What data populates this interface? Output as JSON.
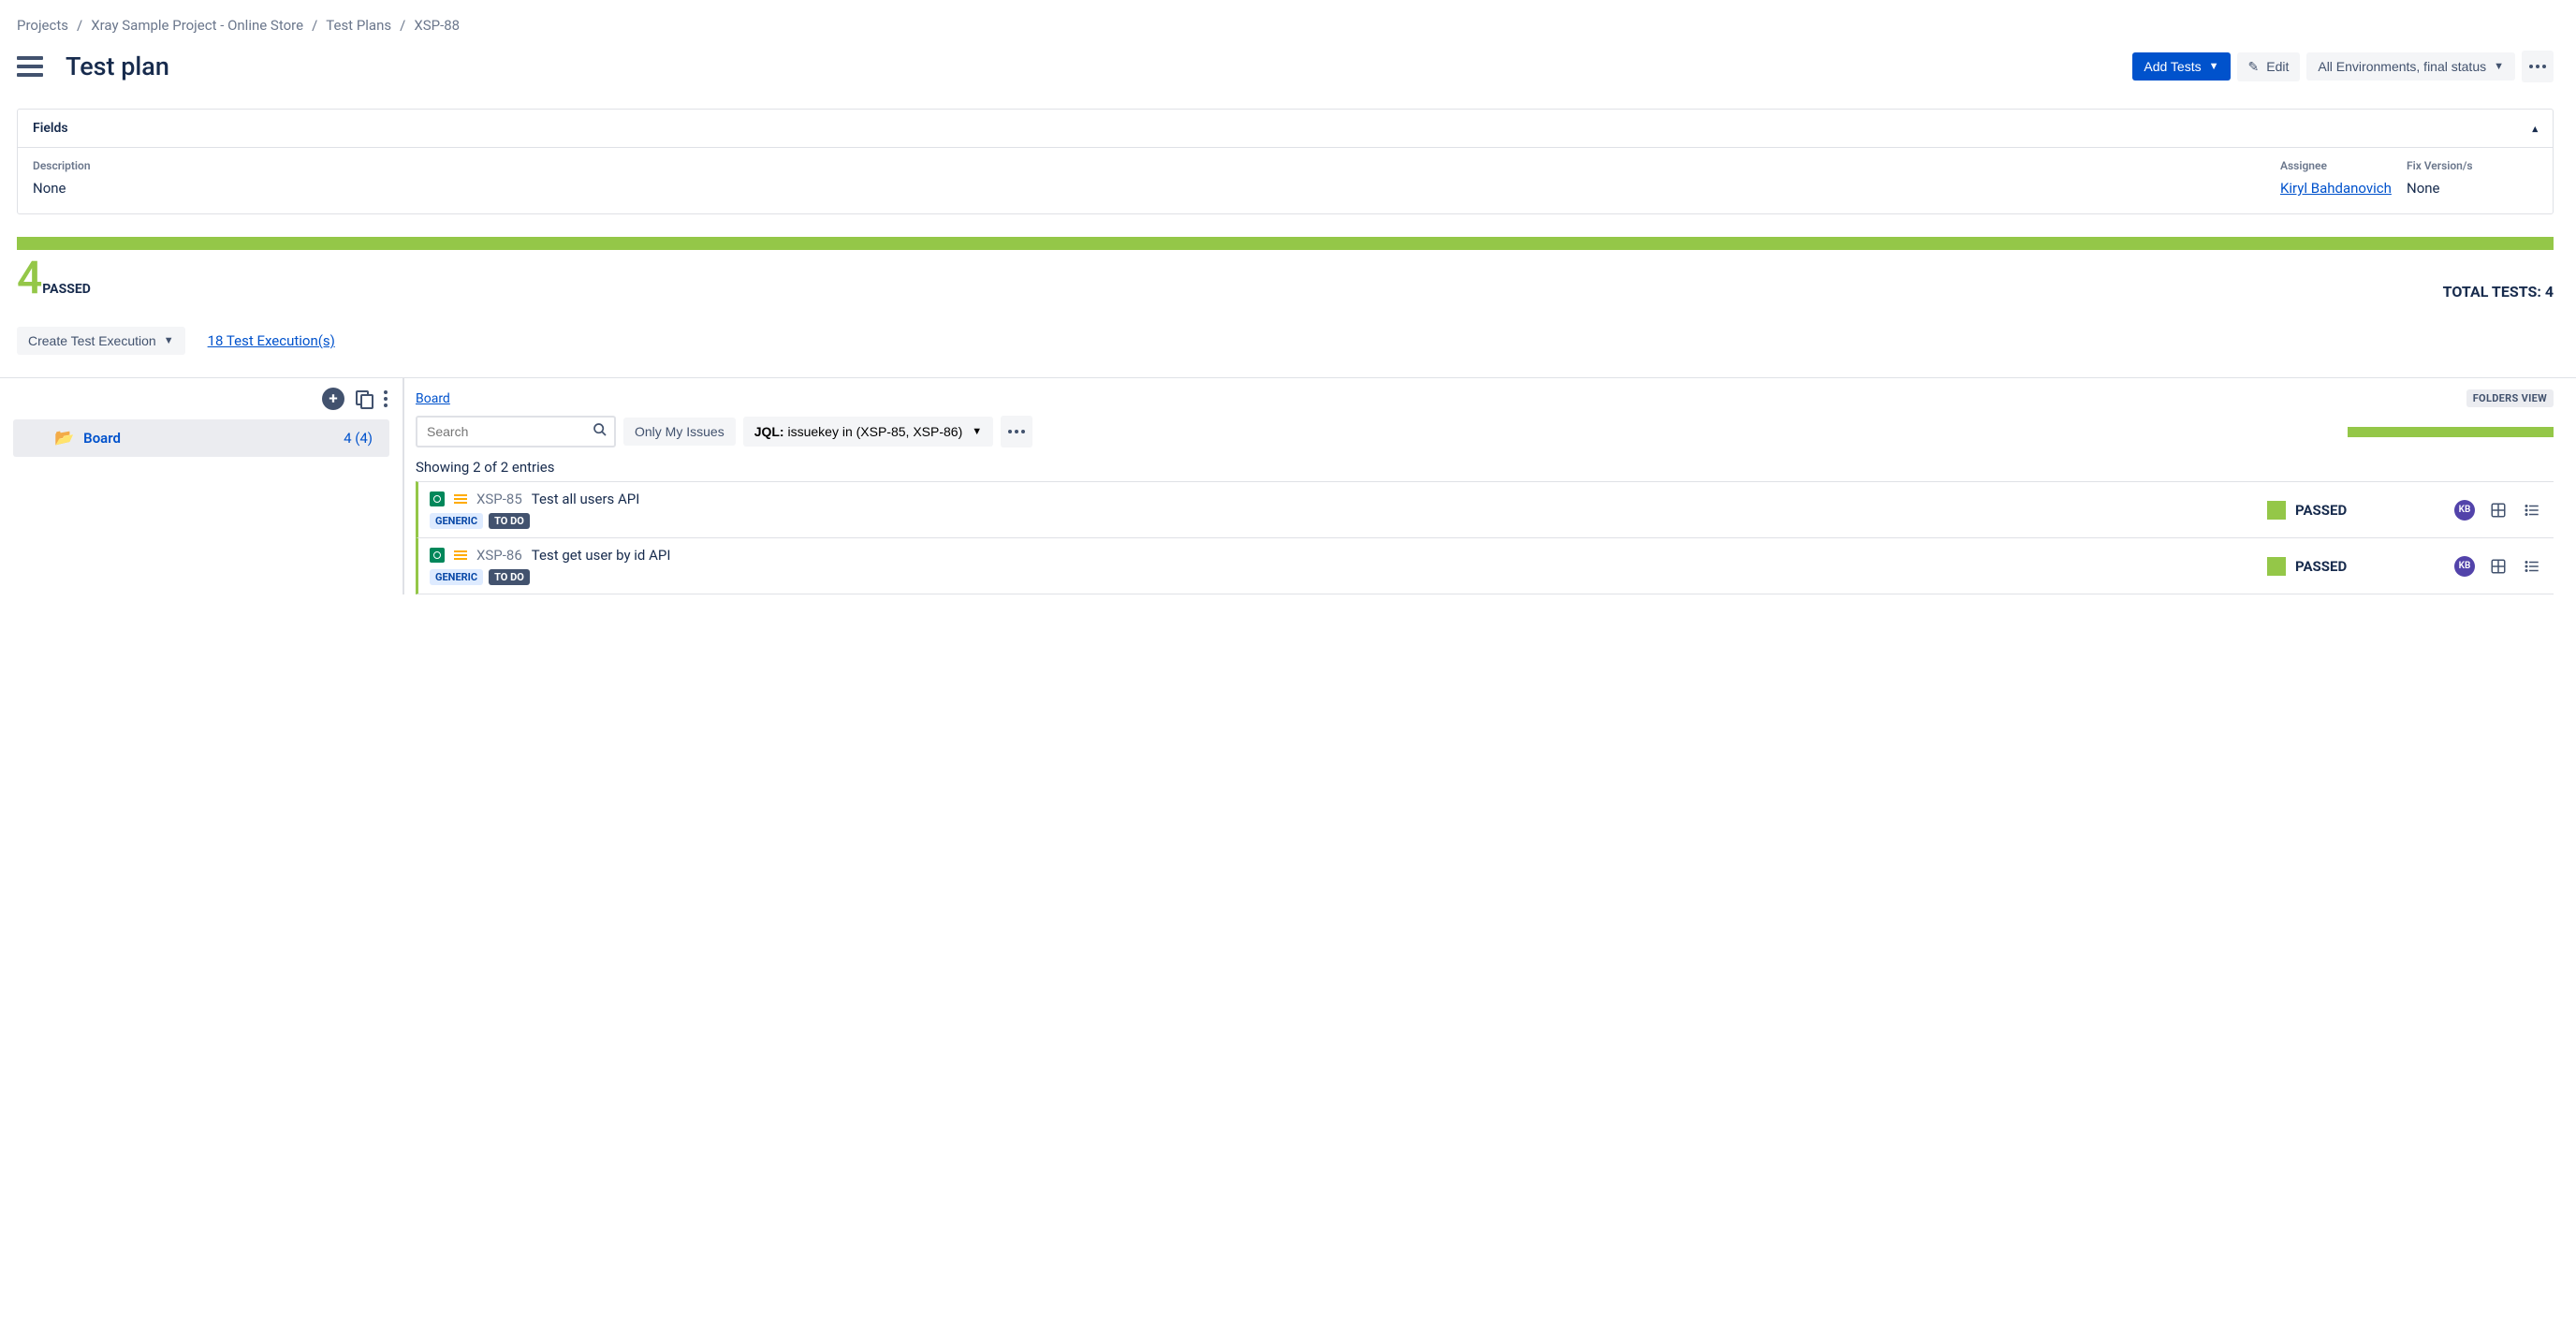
{
  "breadcrumb": [
    "Projects",
    "Xray Sample Project - Online Store",
    "Test Plans",
    "XSP-88"
  ],
  "page_title": "Test plan",
  "toolbar": {
    "add_tests": "Add Tests",
    "edit": "Edit",
    "environments": "All Environments, final status"
  },
  "fields_panel": {
    "title": "Fields",
    "description_label": "Description",
    "description_value": "None",
    "assignee_label": "Assignee",
    "assignee_value": "Kiryl Bahdanovich",
    "fixversion_label": "Fix Version/s",
    "fixversion_value": "None"
  },
  "progress": {
    "count": "4",
    "passed_label": "PASSED",
    "total_label": "TOTAL TESTS: 4"
  },
  "exec": {
    "create_label": "Create Test Execution",
    "executions_link": "18 Test Execution(s)"
  },
  "tree": {
    "board_label": "Board",
    "board_count": "4 (4)"
  },
  "right": {
    "board_crumb": "Board",
    "folders_view": "FOLDERS VIEW",
    "search_placeholder": "Search",
    "only_my": "Only My Issues",
    "jql_label": "JQL:",
    "jql_value": " issuekey in (XSP-85, XSP-86)",
    "showing": "Showing 2 of 2 entries"
  },
  "tests": [
    {
      "key": "XSP-85",
      "summary": "Test all users API",
      "type": "GENERIC",
      "workflow": "TO DO",
      "status": "PASSED",
      "avatar": "KB"
    },
    {
      "key": "XSP-86",
      "summary": "Test get user by id API",
      "type": "GENERIC",
      "workflow": "TO DO",
      "status": "PASSED",
      "avatar": "KB"
    }
  ]
}
